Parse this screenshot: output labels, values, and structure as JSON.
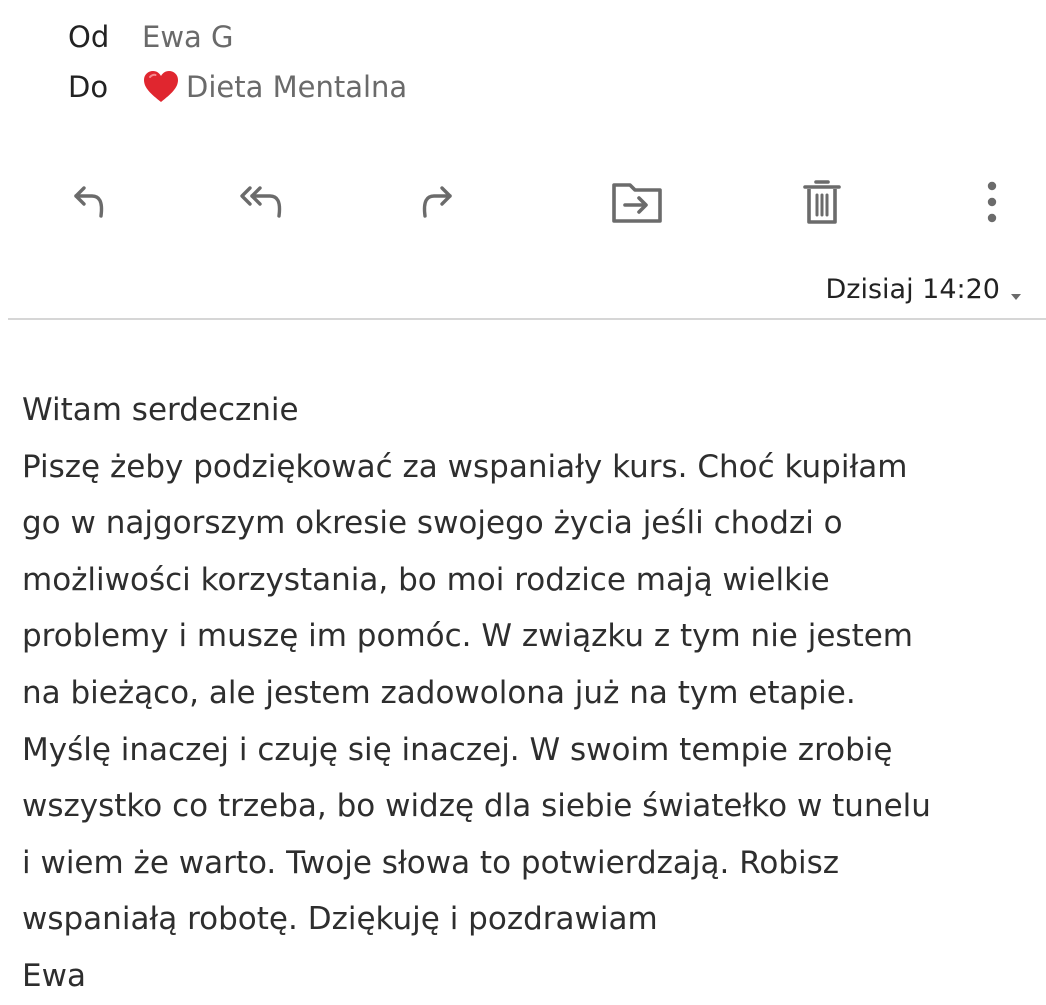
{
  "header": {
    "from_label": "Od",
    "from_value": "Ewa G",
    "to_label": "Do",
    "to_value": "Dieta Mentalna"
  },
  "toolbar": {
    "icons": [
      "reply-icon",
      "reply-all-icon",
      "forward-icon",
      "move-to-folder-icon",
      "delete-icon",
      "more-options-icon"
    ]
  },
  "date": {
    "value": "Dzisiaj 14:20"
  },
  "colors": {
    "icon": "#6b6b6b",
    "heart": "#e0262f",
    "divider": "#d6d6d6"
  },
  "body": {
    "lines": [
      "Witam serdecznie",
      "Piszę żeby podziękować za wspaniały kurs. Choć kupiłam",
      "go w najgorszym okresie swojego życia jeśli chodzi o",
      "możliwości korzystania, bo moi rodzice mają wielkie",
      "problemy i muszę im pomóc. W związku z tym nie jestem",
      "na bieżąco, ale jestem zadowolona już na tym etapie.",
      "Myślę inaczej i czuję się inaczej. W swoim tempie zrobię",
      "wszystko co trzeba, bo widzę dla siebie światełko w tunelu",
      "i wiem że warto. Twoje słowa to potwierdzają. Robisz",
      "wspaniałą  robotę. Dziękuję i pozdrawiam",
      "Ewa"
    ]
  }
}
